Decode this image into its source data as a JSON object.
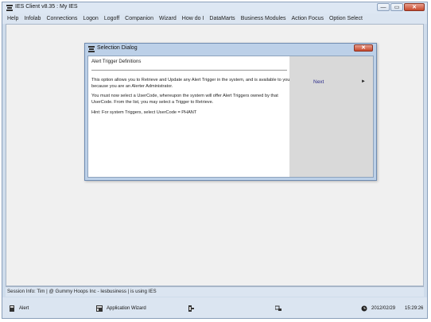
{
  "app": {
    "title": "IES Client v8.35 : My IES",
    "window_controls": {
      "minimize": "—",
      "maximize": "▭",
      "close": "✕"
    }
  },
  "menu": {
    "items": [
      "Help",
      "Infolab",
      "Connections",
      "Logon",
      "Logoff",
      "Companion",
      "Wizard",
      "How do I",
      "DataMarts",
      "Business Modules",
      "Action Focus",
      "Option Select"
    ]
  },
  "dialog": {
    "title": "Selection Dialog",
    "close": "✕",
    "heading": "Alert Trigger Definitions",
    "paragraphs": [
      "This option allows you to Retrieve and Update any Alert Trigger in the system, and is available to you\nbecause you are an Alerter Administrator.",
      "You must now select a UserCode, whereupon the system will offer Alert Triggers owned by that\nUserCode. From the list, you may select a Trigger to Retrieve.",
      "Hint: For system Triggers, select UserCode = PHANT"
    ],
    "next_label": "Next",
    "next_arrow": "►"
  },
  "status": {
    "session_info": "Session Info: Tim | @ Gummy Hoops Inc  - Iesbusiness | is using IES"
  },
  "taskbar": {
    "alert_label": "Alert",
    "wizard_label": "Application Wizard",
    "date": "2012/02/29",
    "time": "15:29:26"
  },
  "colors": {
    "accent": "#2c2c8a",
    "window_frame": "#cfdceb",
    "close_red": "#c7472b"
  },
  "icons": [
    "app-logo-icon",
    "alert-icon",
    "wizard-icon",
    "tool-icon",
    "network-icon",
    "clock-icon"
  ]
}
